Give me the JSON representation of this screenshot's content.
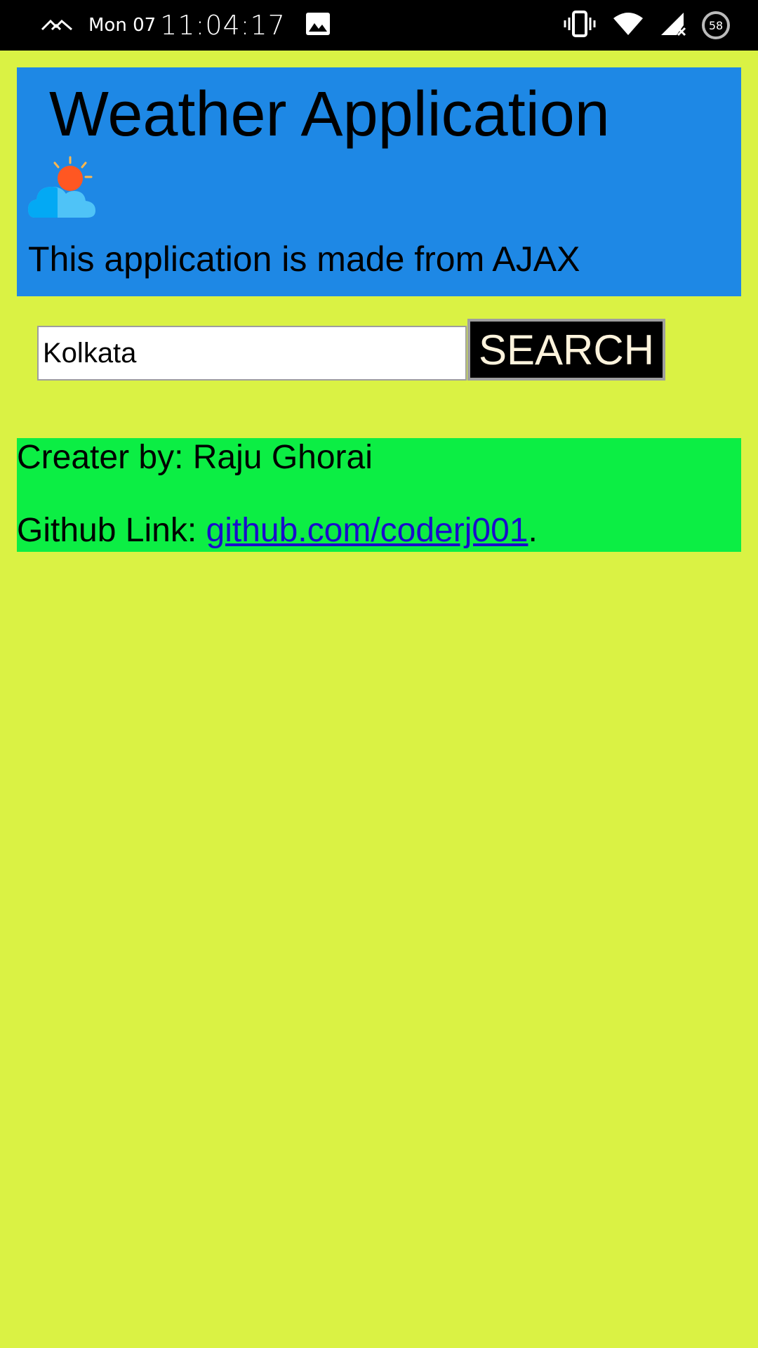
{
  "status_bar": {
    "day": "Mon 07",
    "time": "11:04:17",
    "battery_level": "58"
  },
  "header": {
    "title": "Weather Application",
    "subtitle": "This application is made from AJAX"
  },
  "search": {
    "value": "Kolkata",
    "button_label": "SEARCH"
  },
  "credit": {
    "creator_label": "Creater by:",
    "creator_name": "Raju Ghorai",
    "github_label": "Github Link:",
    "github_link_text": "github.com/coderj001",
    "trailing": "."
  },
  "colors": {
    "page_background": "#daf244",
    "header_background": "#1e88e5",
    "credit_background": "#0cee44",
    "button_background": "#000000",
    "link": "#1a0dcc"
  },
  "icons": [
    "signal-activity-icon",
    "gallery-icon",
    "vibrate-icon",
    "wifi-icon",
    "cell-signal-icon",
    "battery-icon",
    "weather-partly-cloudy-icon"
  ]
}
